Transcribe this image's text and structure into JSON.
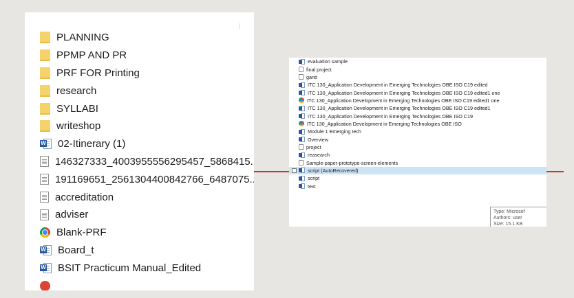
{
  "left_panel": {
    "items": [
      {
        "label": "PLANNING",
        "icon": "folder-icon"
      },
      {
        "label": "PPMP AND PR",
        "icon": "folder-icon"
      },
      {
        "label": "PRF FOR Printing",
        "icon": "folder-icon"
      },
      {
        "label": "research",
        "icon": "folder-icon"
      },
      {
        "label": "SYLLABI",
        "icon": "folder-icon"
      },
      {
        "label": "writeshop",
        "icon": "folder-icon"
      },
      {
        "label": "02-Itinerary (1)",
        "icon": "word-icon"
      },
      {
        "label": "146327333_4003955556295457_5868415...",
        "icon": "file-icon"
      },
      {
        "label": "191169651_2561304400842766_6487075...",
        "icon": "file-icon"
      },
      {
        "label": "accreditation",
        "icon": "file-icon"
      },
      {
        "label": "adviser",
        "icon": "file-icon"
      },
      {
        "label": "Blank-PRF",
        "icon": "chrome-icon"
      },
      {
        "label": "Board_t",
        "icon": "word-icon"
      },
      {
        "label": "BSIT Practicum Manual_Edited",
        "icon": "word-icon"
      },
      {
        "label": "",
        "icon": "partial-icon"
      }
    ]
  },
  "right_panel": {
    "items": [
      {
        "label": "evaluation sample",
        "icon": "word-icon"
      },
      {
        "label": "final project",
        "icon": "file-icon"
      },
      {
        "label": "gantt",
        "icon": "file-icon"
      },
      {
        "label": "ITC 130_Application Development in Emerging Technologies OBE ISO C19 edited",
        "icon": "word-icon"
      },
      {
        "label": "ITC 130_Application Development in Emerging Technologies OBE ISO C19 edited1 one",
        "icon": "word-icon"
      },
      {
        "label": "ITC 130_Application Development in Emerging Technologies OBE ISO C19 edited1 one",
        "icon": "chrome-icon"
      },
      {
        "label": "ITC 130_Application Development in Emerging Technologies OBE ISO C19 edited1",
        "icon": "word-icon"
      },
      {
        "label": "ITC 130_Application Development in Emerging Technologies OBE ISO C19",
        "icon": "word-icon"
      },
      {
        "label": "ITC 130_Application Development in Emerging Technologies OBE ISO",
        "icon": "chrome-icon"
      },
      {
        "label": "Module 1 Emerging tech",
        "icon": "word-icon"
      },
      {
        "label": "Overview",
        "icon": "word-icon"
      },
      {
        "label": "project",
        "icon": "file-icon"
      },
      {
        "label": "reasearch",
        "icon": "word-icon"
      },
      {
        "label": "Sample-paper-prototype-screen-elements",
        "icon": "file-icon"
      },
      {
        "label": "script (AutoRecovered)",
        "icon": "word-icon",
        "selected": true
      },
      {
        "label": "script",
        "icon": "word-icon"
      },
      {
        "label": "text",
        "icon": "word-icon"
      }
    ],
    "tooltip": {
      "type_line": "Type: Microsof",
      "authors_line": "Authors: user",
      "size_line": "Size: 15.1 KB"
    }
  },
  "colors": {
    "background": "#e8e6e3",
    "accent_line": "#c0392b",
    "folder": "#f6d26a",
    "word": "#2b579a",
    "selection": "#cce4f7"
  }
}
